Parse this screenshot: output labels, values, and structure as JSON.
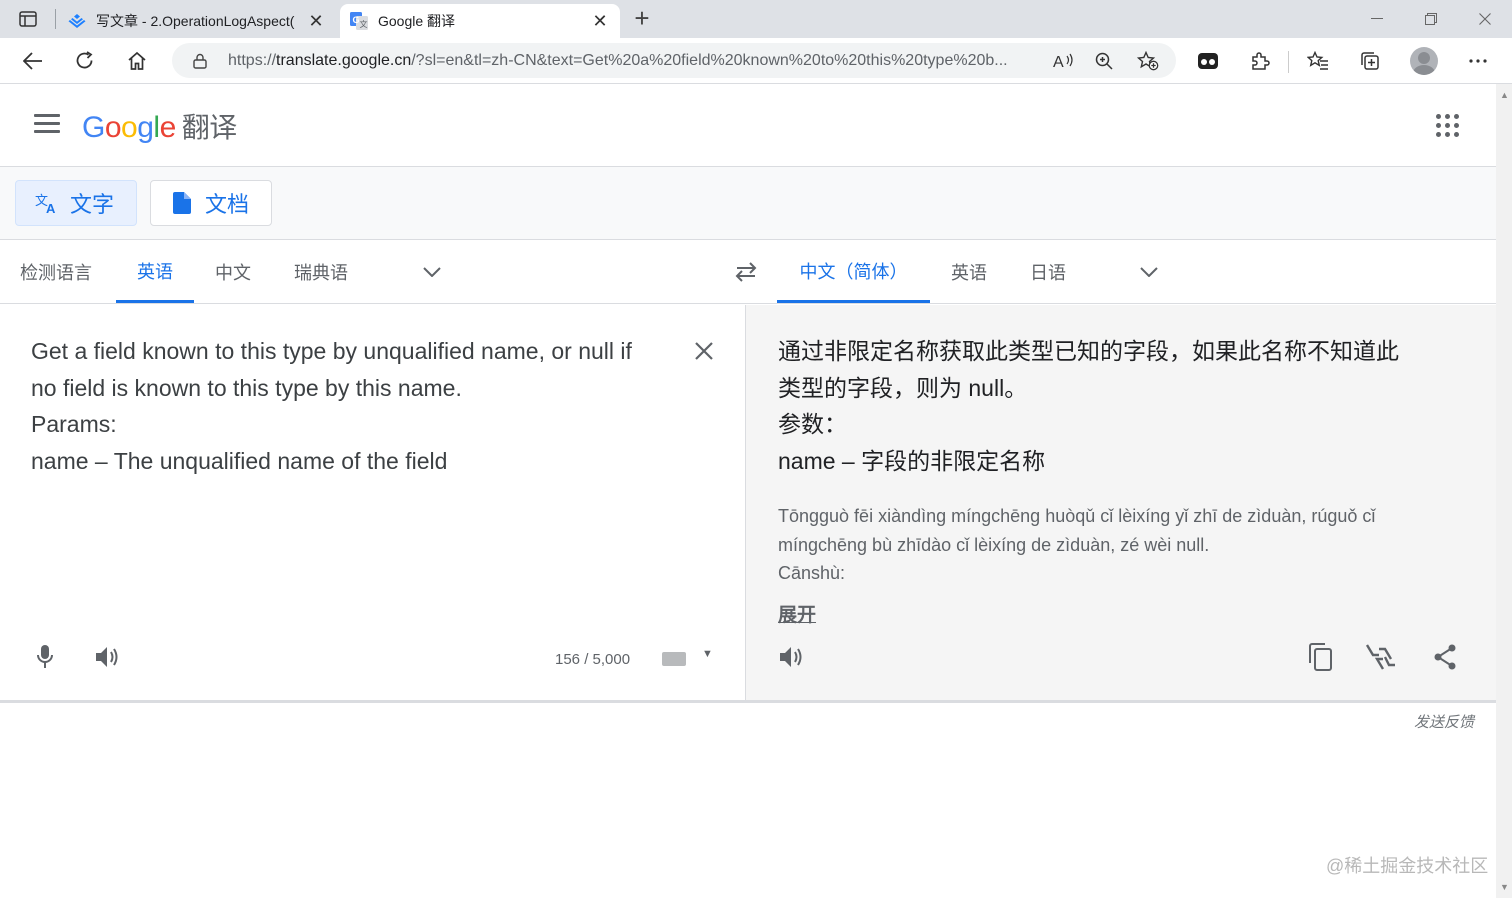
{
  "browser": {
    "tabs": [
      {
        "title": "写文章 - 2.OperationLogAspect(",
        "active": false
      },
      {
        "title": "Google 翻译",
        "active": true
      }
    ],
    "url_prefix": "https://",
    "url_host": "translate.google.cn",
    "url_rest": "/?sl=en&tl=zh-CN&text=Get%20a%20field%20known%20to%20this%20type%20b..."
  },
  "header": {
    "logo_letters": [
      "G",
      "o",
      "o",
      "g",
      "l",
      "e"
    ],
    "logo_suffix": "翻译"
  },
  "modes": {
    "text_label": "文字",
    "doc_label": "文档"
  },
  "source_langs": [
    "检测语言",
    "英语",
    "中文",
    "瑞典语"
  ],
  "target_langs": [
    "中文（简体）",
    "英语",
    "日语"
  ],
  "source": {
    "lines": [
      "Get a field known to this type by unqualified name, or null if",
      "no field is known to this type by this name.",
      "Params:",
      "name – The unqualified name of the field"
    ],
    "char_count": "156 / 5,000"
  },
  "target": {
    "lines": [
      "通过非限定名称获取此类型已知的字段，如果此名称不知道此",
      "类型的字段，则为 null。",
      "参数：",
      "name – 字段的非限定名称"
    ],
    "transliteration": [
      "Tōngguò fēi xiàndìng míngchēng huòqǔ cǐ lèixíng yǐ zhī de zìduàn, rúguǒ cǐ",
      "míngchēng bù zhīdào cǐ lèixíng de zìduàn, zé wèi null.",
      "Cānshù:"
    ],
    "expand_label": "展开"
  },
  "footer": {
    "feedback": "发送反馈",
    "watermark": "@稀土掘金技术社区"
  },
  "colors": {
    "accent": "#1a73e8",
    "target_bg": "#f5f5f5"
  }
}
